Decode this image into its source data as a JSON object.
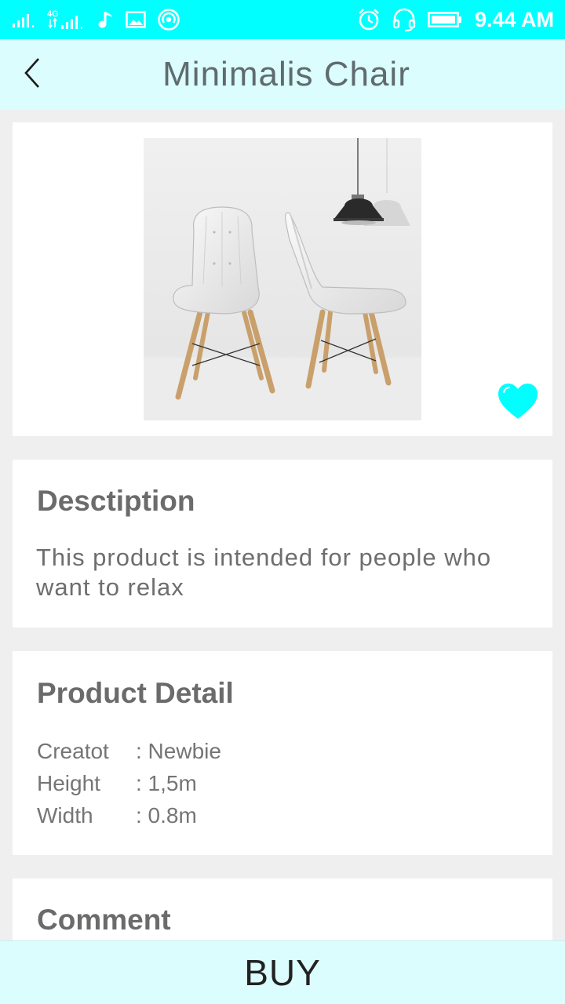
{
  "status_bar": {
    "clock": "9.44 AM",
    "network_label": "4G",
    "icons": [
      "signal-icon",
      "signal-4g-icon",
      "music-note-icon",
      "image-icon",
      "hotspot-icon",
      "alarm-icon",
      "headset-icon",
      "battery-icon"
    ],
    "color": "#00ffff"
  },
  "header": {
    "title": "Minimalis Chair",
    "back_icon": "chevron-left-icon",
    "background": "#dcfdfd"
  },
  "product": {
    "image_icon": "chair-photo",
    "favorite_icon": "heart-icon",
    "favorite_active": true,
    "accent": "#00ffff"
  },
  "description": {
    "title": "Desctiption",
    "text_line1": "This product is intended for people who",
    "text_line2": "want to relax"
  },
  "product_detail": {
    "title": "Product Detail",
    "rows": [
      {
        "label": "Creatot",
        "value": ": Newbie"
      },
      {
        "label": "Height",
        "value": ": 1,5m"
      },
      {
        "label": "Width",
        "value": ": 0.8m"
      }
    ]
  },
  "comment": {
    "title": "Comment"
  },
  "buy": {
    "label": "BUY"
  }
}
